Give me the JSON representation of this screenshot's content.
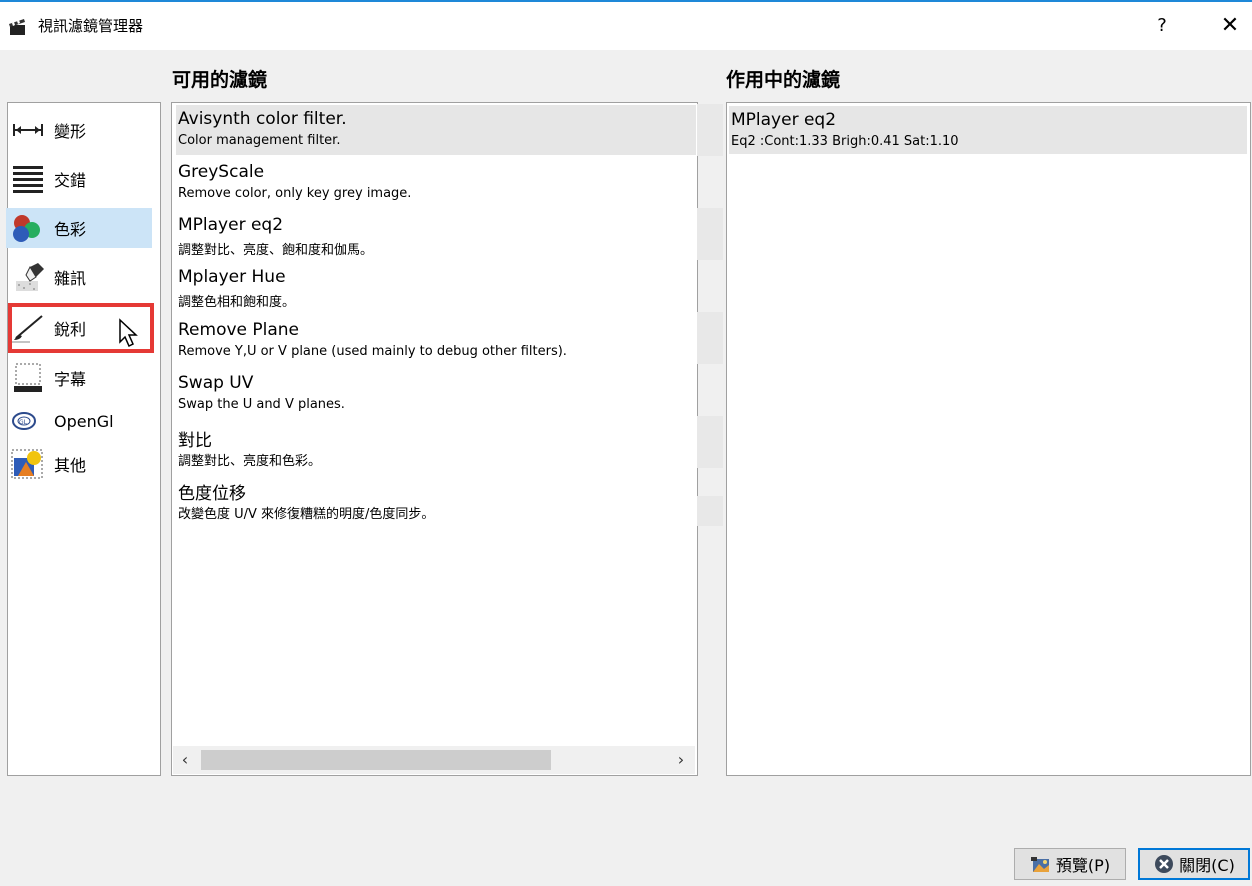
{
  "window": {
    "title": "視訊濾鏡管理器",
    "help_label": "?",
    "close_label": "✕"
  },
  "sections": {
    "available_label": "可用的濾鏡",
    "active_label": "作用中的濾鏡"
  },
  "categories": [
    {
      "label": "變形",
      "icon": "transform-arrows-icon",
      "selected": false
    },
    {
      "label": "交錯",
      "icon": "interlace-lines-icon",
      "selected": false
    },
    {
      "label": "色彩",
      "icon": "color-balls-icon",
      "selected": true
    },
    {
      "label": "雜訊",
      "icon": "noise-eraser-icon",
      "selected": false
    },
    {
      "label": "銳利",
      "icon": "sharpen-brush-icon",
      "selected": false
    },
    {
      "label": "字幕",
      "icon": "subtitle-icon",
      "selected": false
    },
    {
      "label": "OpenGl",
      "icon": "opengl-icon",
      "selected": false
    },
    {
      "label": "其他",
      "icon": "misc-shapes-icon",
      "selected": false
    }
  ],
  "available_filters": [
    {
      "name": "Avisynth color filter.",
      "desc": "Color management filter."
    },
    {
      "name": "GreyScale",
      "desc": "Remove color, only key grey image."
    },
    {
      "name": "MPlayer eq2",
      "desc": "調整對比、亮度、飽和度和伽馬。"
    },
    {
      "name": "Mplayer Hue",
      "desc": "調整色相和飽和度。"
    },
    {
      "name": "Remove Plane",
      "desc": "Remove Y,U or V plane (used mainly to debug other filters)."
    },
    {
      "name": "Swap UV",
      "desc": "Swap the U and V planes."
    },
    {
      "name": "對比",
      "desc": "調整對比、亮度和色彩。"
    },
    {
      "name": "色度位移",
      "desc": "改變色度 U/V 來修復糟糕的明度/色度同步。"
    }
  ],
  "active_filters": [
    {
      "name": "MPlayer eq2",
      "desc": "Eq2 :Cont:1.33 Brigh:0.41 Sat:1.10"
    }
  ],
  "scrollbar": {
    "left_arrow": "‹",
    "right_arrow": "›"
  },
  "buttons": {
    "preview_label": "預覽(P)",
    "close_label": "關閉(C)"
  },
  "colors": {
    "highlight": "#e53935",
    "selection": "#cce4f7",
    "accent": "#0078d7"
  }
}
